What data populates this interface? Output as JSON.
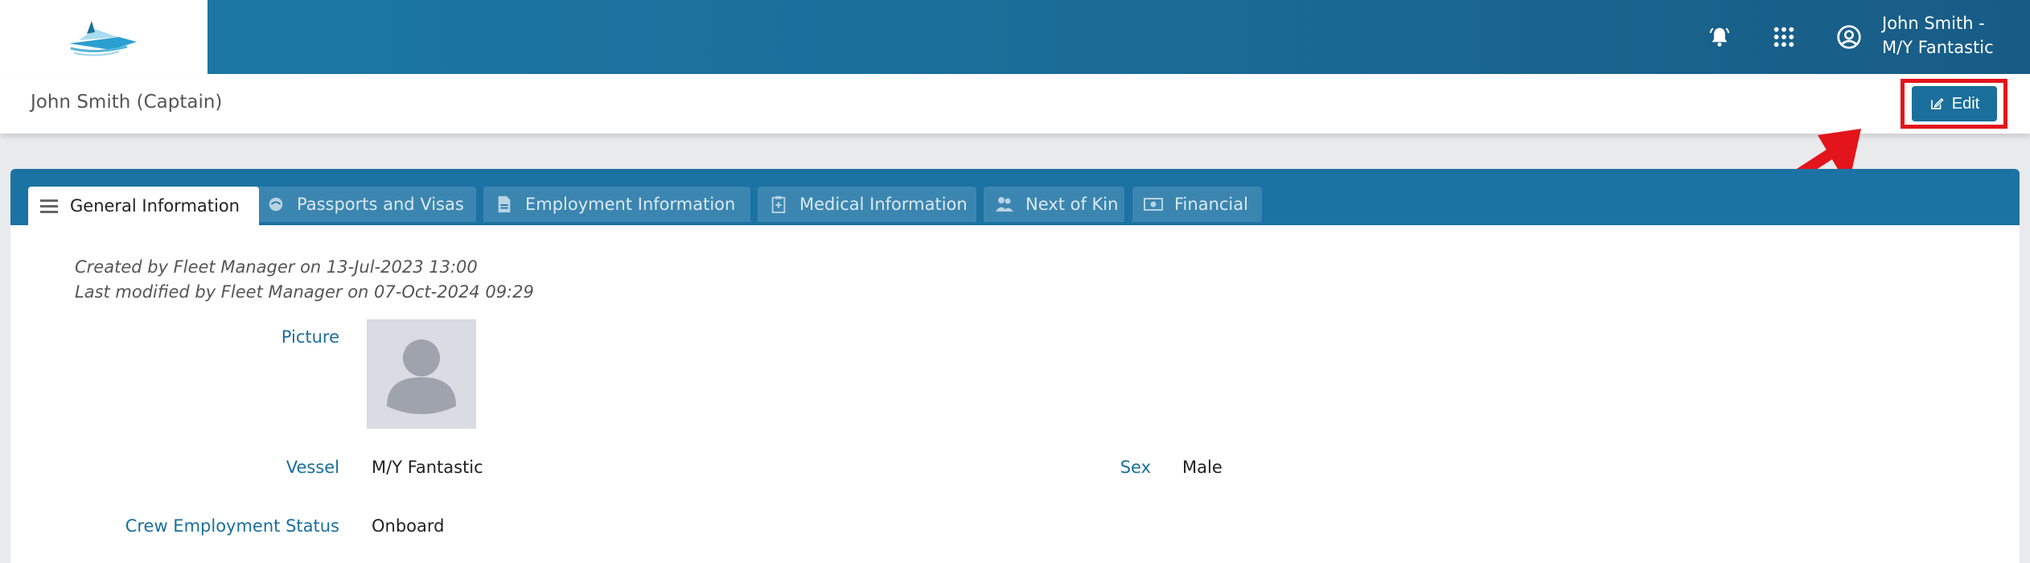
{
  "topbar": {
    "bell_icon": "bell-icon",
    "apps_icon": "apps-grid-icon",
    "user_icon": "user-circle-icon",
    "user_name": "John Smith -\nM/Y Fantastic"
  },
  "header": {
    "title": "John Smith (Captain)",
    "edit_label": "Edit",
    "annotation_color": "#e3141b"
  },
  "tabs": [
    {
      "label": "General Information",
      "icon": "list-icon"
    },
    {
      "label": "Passports and Visas",
      "icon": "passport-icon"
    },
    {
      "label": "Employment Information",
      "icon": "document-icon"
    },
    {
      "label": "Medical Information",
      "icon": "medical-clipboard-icon"
    },
    {
      "label": "Next of Kin",
      "icon": "people-icon"
    },
    {
      "label": "Financial",
      "icon": "money-icon"
    }
  ],
  "general": {
    "created": "Created by Fleet Manager on 13-Jul-2023 13:00",
    "modified": "Last modified by Fleet Manager on 07-Oct-2024 09:29",
    "picture_label": "Picture",
    "vessel_label": "Vessel",
    "vessel_value": "M/Y Fantastic",
    "sex_label": "Sex",
    "sex_value": "Male",
    "status_label": "Crew Employment Status",
    "status_value": "Onboard"
  }
}
